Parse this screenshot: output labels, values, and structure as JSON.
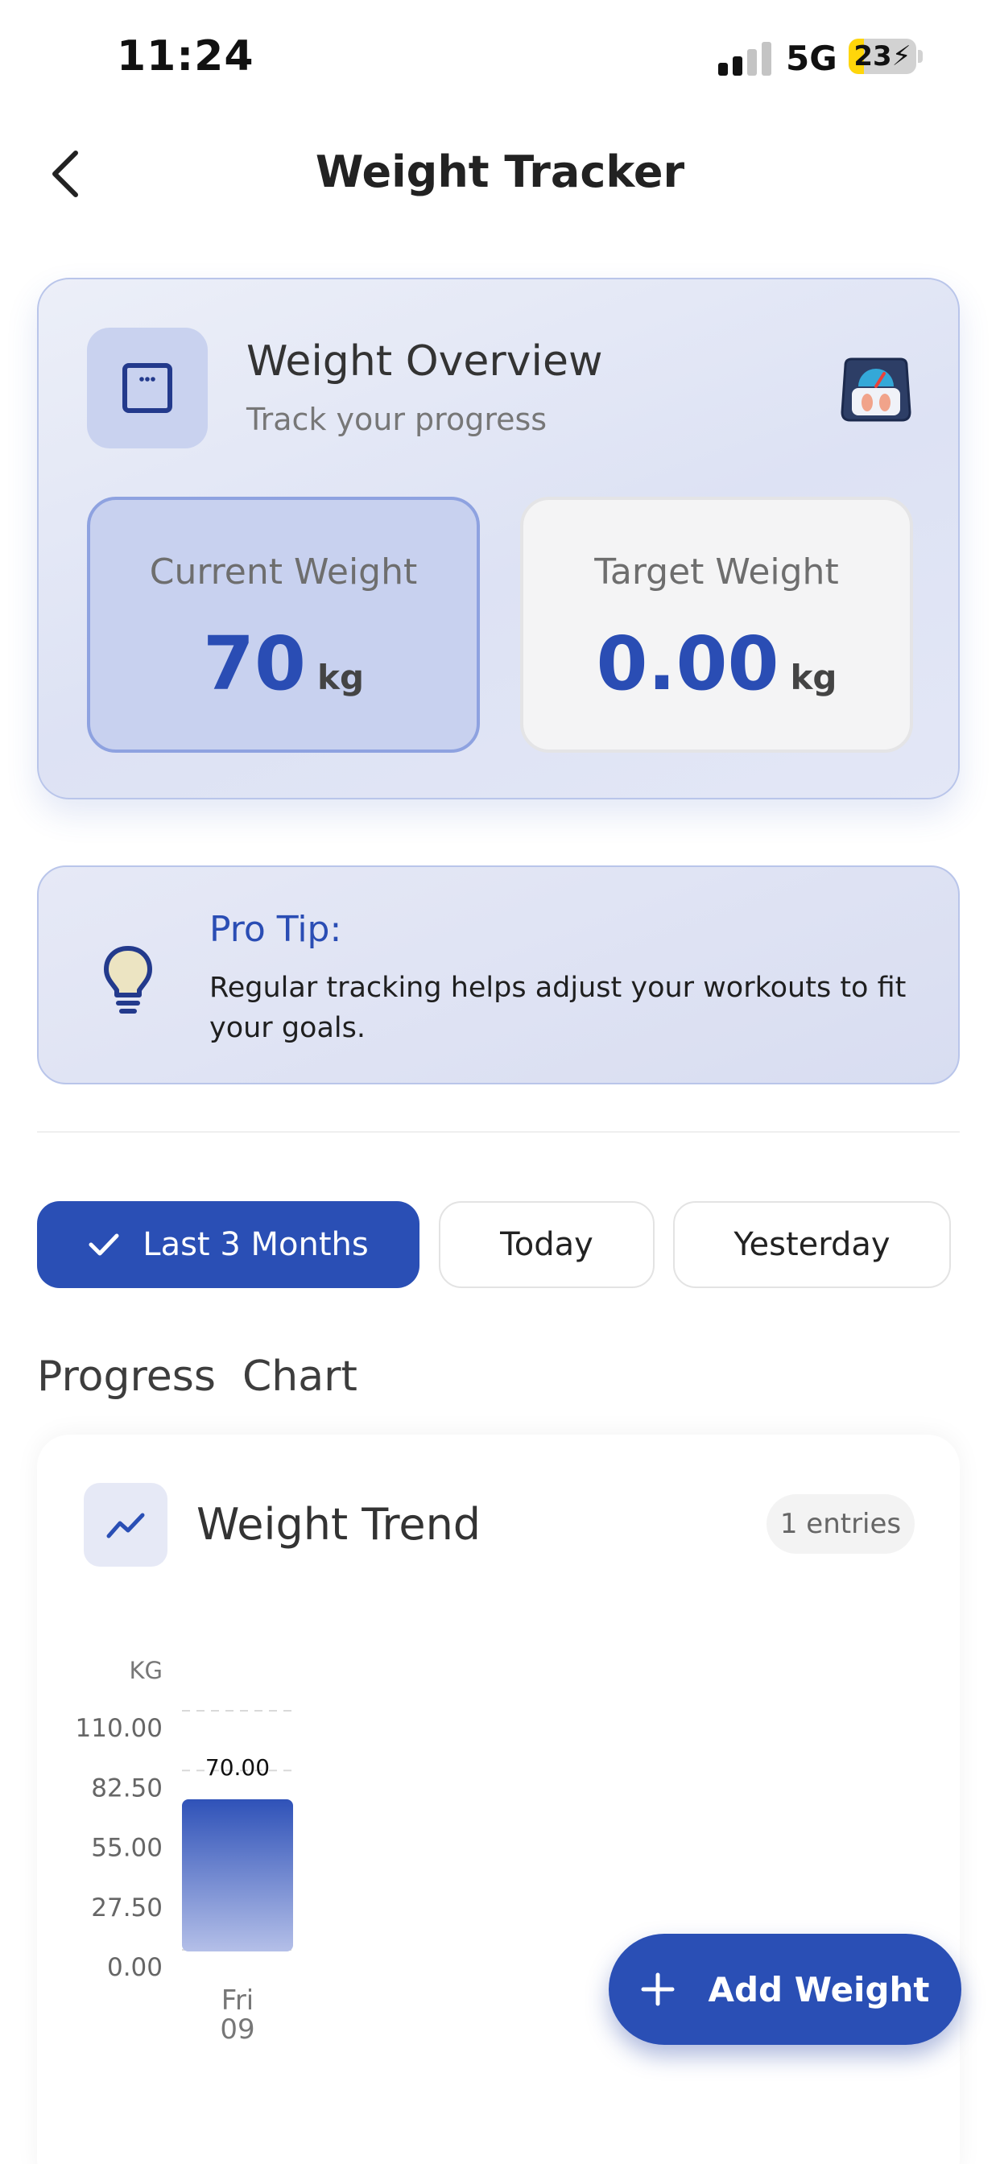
{
  "status_bar": {
    "time": "11:24",
    "network": "5G",
    "battery": "23",
    "battery_level_percent": 23
  },
  "header": {
    "title": "Weight Tracker",
    "back_icon": "chevron-left-icon"
  },
  "overview": {
    "title": "Weight Overview",
    "subtitle": "Track your progress",
    "icon": "scale-square-icon",
    "badge_icon": "bathroom-scale-icon",
    "current": {
      "label": "Current Weight",
      "value": "70",
      "unit": "kg"
    },
    "target": {
      "label": "Target Weight",
      "value": "0.00",
      "unit": "kg"
    }
  },
  "tip": {
    "icon": "lightbulb-icon",
    "title": "Pro Tip:",
    "text": "Regular tracking helps adjust your workouts to fit your goals."
  },
  "filters": [
    {
      "label": "Last 3 Months",
      "active": true,
      "icon": "checkmark-icon"
    },
    {
      "label": "Today",
      "active": false
    },
    {
      "label": "Yesterday",
      "active": false
    }
  ],
  "section_title": "Progress  Chart",
  "chart_card": {
    "title": "Weight Trend",
    "icon": "trend-line-icon",
    "entries": "1 entries"
  },
  "chart_data": {
    "type": "bar",
    "ylabel": "KG",
    "ylim": [
      0,
      110
    ],
    "yticks": [
      "110.00",
      "82.50",
      "55.00",
      "27.50",
      "0.00"
    ],
    "categories": [
      [
        "Fri",
        "09"
      ]
    ],
    "values": [
      70
    ],
    "data_labels": [
      "70.00"
    ],
    "grid": true,
    "colors": {
      "bar_top": "#2f52b8",
      "bar_bottom": "#b4bfe8",
      "grid": "#d9d9d9"
    }
  },
  "fab": {
    "label": "Add Weight",
    "icon": "plus-icon"
  },
  "colors": {
    "accent": "#2a4fb5",
    "card_bg": "#dde2f4",
    "text_primary": "#2a2a2a"
  }
}
